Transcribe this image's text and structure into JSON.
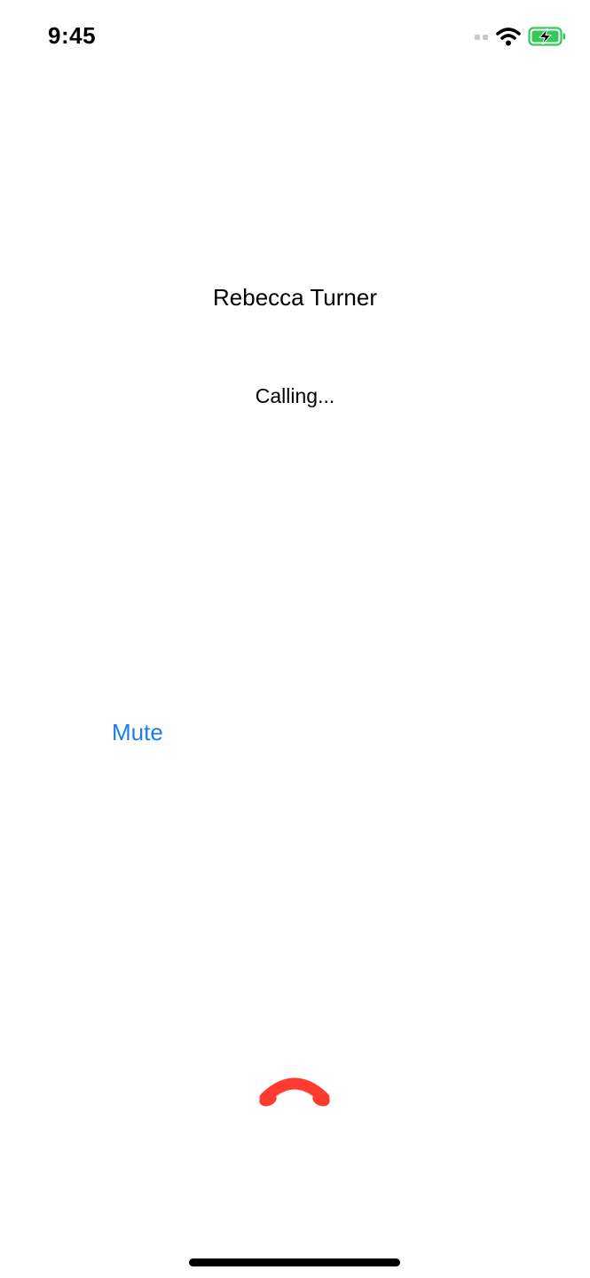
{
  "status_bar": {
    "time": "9:45",
    "icons": [
      "signal-icon",
      "wifi-icon",
      "battery-charging-icon"
    ],
    "battery_color": "#35c759"
  },
  "call": {
    "contact_name": "Rebecca Turner",
    "status_text": "Calling..."
  },
  "controls": {
    "mute_label": "Mute",
    "mute_color": "#1a7ee6",
    "end_call_icon": "end-call-icon",
    "end_call_color": "#ff3b30"
  }
}
